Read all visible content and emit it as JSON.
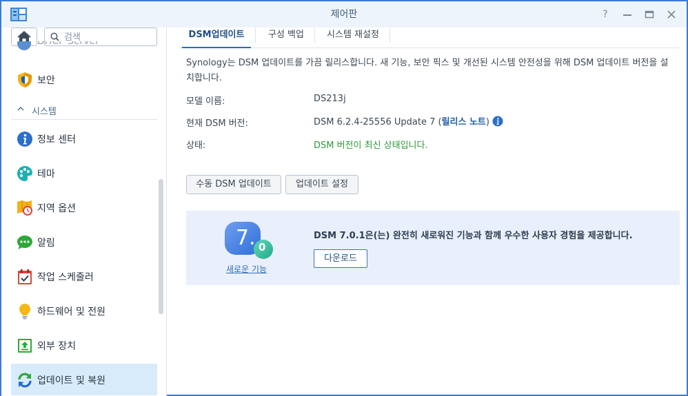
{
  "window": {
    "title": "제어판",
    "controls": [
      "help",
      "minimize",
      "maximize",
      "close"
    ]
  },
  "sidebar": {
    "search_placeholder": "검색",
    "partial_item": "DHCP Server",
    "security_label": "보안",
    "section_label": "시스템",
    "items": [
      {
        "label": "정보 센터",
        "icon": "info-icon"
      },
      {
        "label": "테마",
        "icon": "palette-icon"
      },
      {
        "label": "지역 옵션",
        "icon": "map-clock-icon"
      },
      {
        "label": "알림",
        "icon": "chat-bubble-icon"
      },
      {
        "label": "작업 스케줄러",
        "icon": "calendar-check-icon"
      },
      {
        "label": "하드웨어 및 전원",
        "icon": "lightbulb-icon"
      },
      {
        "label": "외부 장치",
        "icon": "upload-device-icon"
      },
      {
        "label": "업데이트 및 복원",
        "icon": "refresh-icon",
        "selected": true
      }
    ]
  },
  "tabs": [
    {
      "label": "DSM업데이트",
      "active": true
    },
    {
      "label": "구성 백업"
    },
    {
      "label": "시스템 재설정"
    }
  ],
  "content": {
    "description": "Synology는 DSM 업데이트를 가끔 릴리스합니다. 새 기능, 보안 픽스 및 개선된 시스템 안전성을 위해 DSM 업데이트 버전을 설치합니다.",
    "model_label": "모델 이름:",
    "model_value": "DS213j",
    "version_label": "현재 DSM 버전:",
    "version_value": "DSM 6.2.4-25556 Update 7 (",
    "release_notes_link": "릴리스 노트",
    "version_close": ")",
    "status_label": "상태:",
    "status_value": "DSM 버전이 최신 상태입니다.",
    "manual_update_button": "수동 DSM 업데이트",
    "update_settings_button": "업데이트 설정"
  },
  "promo": {
    "logo_text": "7.",
    "logo_badge": "0",
    "new_features_link": "새로운 기능",
    "message": "DSM 7.0.1은(는) 완전히 새로워진 기능과 함께 우수한 사용자 경험을 제공합니다.",
    "download_button": "다운로드"
  },
  "colors": {
    "accent": "#1f6bd5",
    "status_ok": "#2e9a39",
    "selected_bg": "#d8ebfb",
    "promo_bg": "#e9effb"
  }
}
